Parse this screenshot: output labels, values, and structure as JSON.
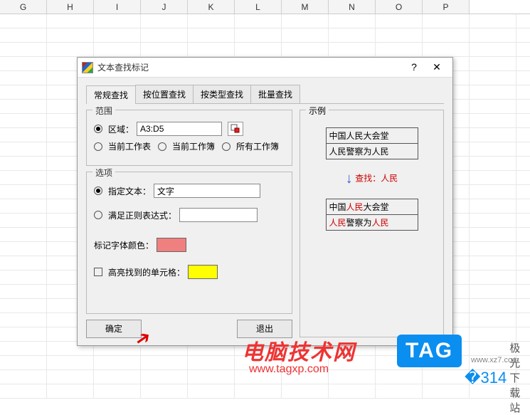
{
  "columns": [
    "G",
    "H",
    "I",
    "J",
    "K",
    "L",
    "M",
    "N",
    "O",
    "P"
  ],
  "dialog": {
    "title": "文本查找标记",
    "help": "?",
    "close": "✕",
    "tabs": [
      "常规查找",
      "按位置查找",
      "按类型查找",
      "批量查找"
    ],
    "range": {
      "legend": "范围",
      "region": "区域：",
      "region_val": "A3:D5",
      "cur_sheet": "当前工作表",
      "cur_book": "当前工作簿",
      "all_books": "所有工作簿"
    },
    "opts": {
      "legend": "选项",
      "spec_text": "指定文本：",
      "spec_val": "文字",
      "regex": "满足正则表达式：",
      "regex_val": "",
      "mark_color": "标记字体颜色：",
      "mark_color_val": "#f08080",
      "hilite": "高亮找到的单元格：",
      "hilite_val": "#ffff00"
    },
    "ok": "确定",
    "exit": "退出",
    "example": {
      "legend": "示例",
      "before": [
        "中国人民大会堂",
        "人民警察为人民"
      ],
      "find_label": "查找：人民",
      "after": [
        [
          {
            "t": "中国"
          },
          {
            "t": "人民",
            "r": 1
          },
          {
            "t": "大会堂"
          }
        ],
        [
          {
            "t": "人民",
            "r": 1
          },
          {
            "t": "警察为"
          },
          {
            "t": "人民",
            "r": 1
          }
        ]
      ]
    }
  },
  "brand1": "电脑技术网",
  "brand1u": "www.tagxp.com",
  "tag": "TAG",
  "brand2": "极光下载站",
  "brand2u": "www.xz7.com"
}
